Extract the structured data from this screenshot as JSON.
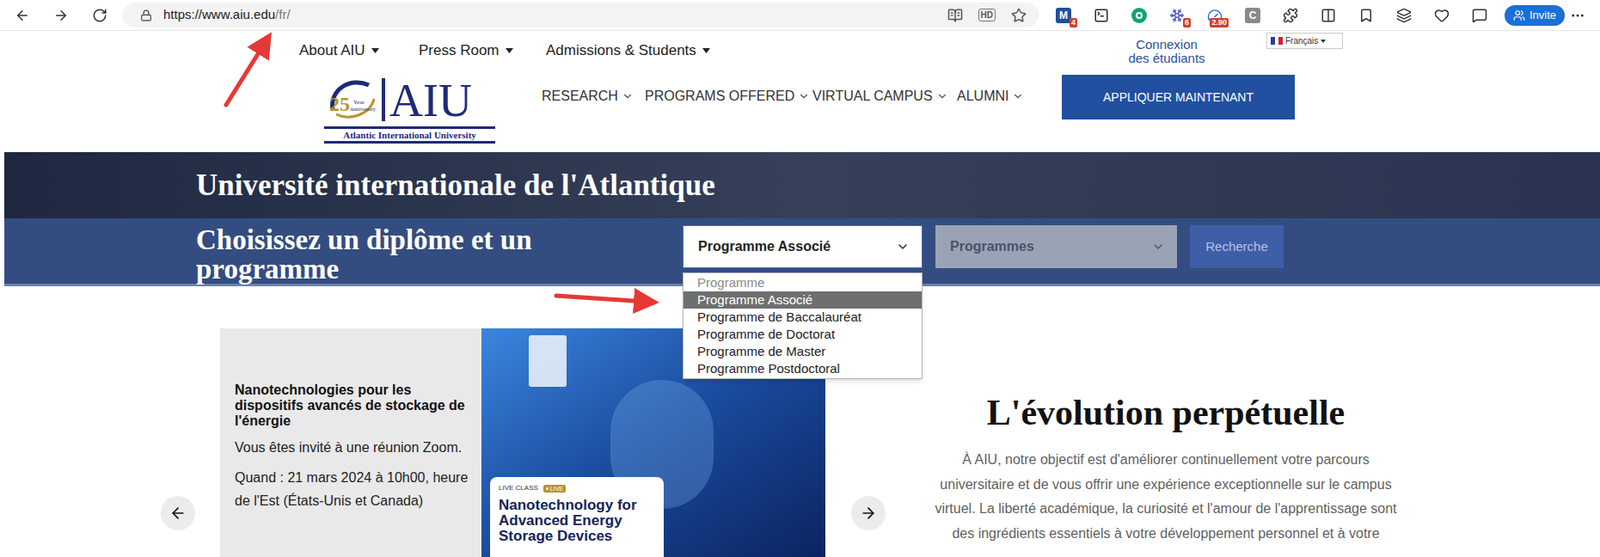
{
  "browser": {
    "url": {
      "host": "https://www.aiu.edu",
      "path": "/fr/"
    },
    "hd_badge": "HD",
    "extensions": [
      {
        "label": "M",
        "badge": "4",
        "color": "#1f4e9d"
      },
      {
        "icon": "terminal",
        "color": "#2b2b2b"
      },
      {
        "icon": "grammar",
        "color": "#15a36b"
      },
      {
        "icon": "snow",
        "badge": "6",
        "color": "#4b55c8"
      },
      {
        "icon": "gauge",
        "badge": "2.90",
        "color": "#1c6ed6"
      },
      {
        "label": "C",
        "color": "#8a8a8a"
      }
    ],
    "invite": "Invite"
  },
  "top_nav": [
    {
      "label": "About AIU"
    },
    {
      "label": "Press Room"
    },
    {
      "label": "Admissions & Students"
    }
  ],
  "student_login": {
    "lines": [
      "Connexion",
      "des étudiants"
    ]
  },
  "language": {
    "label": "Français"
  },
  "logo": {
    "years": "25",
    "year_word": "Year",
    "anniversary": "Anniversary",
    "acronym": "AIU",
    "name": "Atlantic International University"
  },
  "main_nav": [
    {
      "label": "RESEARCH"
    },
    {
      "label": "PROGRAMS OFFERED"
    },
    {
      "label": "VIRTUAL CAMPUS"
    },
    {
      "label": "ALUMNI"
    }
  ],
  "apply_button": "APPLIQUER MAINTENANT",
  "hero": {
    "title": "Université internationale de l'Atlantique",
    "subtitle_lines": [
      "Choisissez un diplôme et un",
      "programme"
    ],
    "degree_select": {
      "value": "Programme Associé",
      "open": true,
      "options": [
        {
          "label": "Programme",
          "selected": false,
          "disabled": true
        },
        {
          "label": "Programme Associé",
          "selected": true,
          "disabled": false
        },
        {
          "label": "Programme de Baccalauréat",
          "selected": false,
          "disabled": false
        },
        {
          "label": "Programme de Doctorat",
          "selected": false,
          "disabled": false
        },
        {
          "label": "Programme de Master",
          "selected": false,
          "disabled": false
        },
        {
          "label": "Programme Postdoctoral",
          "selected": false,
          "disabled": false
        }
      ]
    },
    "program_select": {
      "placeholder": "Programmes",
      "disabled": true
    },
    "search_button": {
      "label": "Recherche",
      "disabled": true
    }
  },
  "slide": {
    "title": "Nanotechnologies pour les dispositifs avancés de stockage de l'énergie",
    "lines": [
      "Vous êtes invité à une réunion Zoom.",
      "Quand : 21 mars 2024 à 10h00, heure de l'Est (États-Unis et Canada)"
    ],
    "banner": {
      "kicker": "LIVE CLASS",
      "badge": "LIVE",
      "title": "Nanotechnology for Advanced Energy Storage Devices"
    }
  },
  "about": {
    "heading": "L'évolution perpétuelle",
    "lines": [
      "À AIU, notre objectif est d'améliorer continuellement votre parcours",
      "universitaire et de vous offrir une expérience exceptionnelle sur le campus",
      "virtuel. La liberté académique, la curiosité et l'amour de l'apprentissage sont",
      "des ingrédients essentiels à votre développement personnel et à votre"
    ]
  }
}
